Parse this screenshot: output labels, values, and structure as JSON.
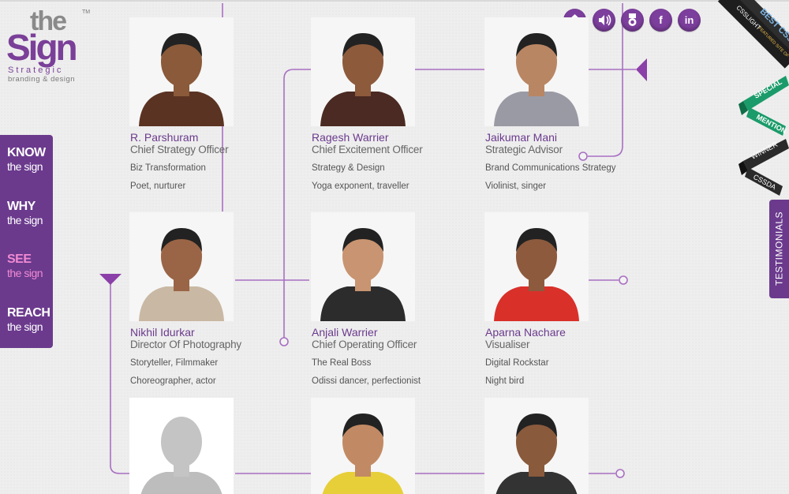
{
  "logo": {
    "the": "the",
    "tm": "TM",
    "sign": "Sign",
    "tagline1": "Strategic",
    "tagline2": "branding & design"
  },
  "nav": [
    {
      "key": "KNOW",
      "sub": "the sign"
    },
    {
      "key": "WHY",
      "sub": "the sign"
    },
    {
      "key": "SEE",
      "sub": "the sign",
      "active": true
    },
    {
      "key": "REACH",
      "sub": "the sign"
    }
  ],
  "social": [
    {
      "icon": "home-icon"
    },
    {
      "icon": "speaker-icon"
    },
    {
      "icon": "award-icon"
    },
    {
      "icon": "facebook-icon",
      "label": "f"
    },
    {
      "icon": "linkedin-icon",
      "label": "in"
    }
  ],
  "people": [
    {
      "name": "R. Parshuram",
      "role": "Chief Strategy Officer",
      "line1": "Biz Transformation",
      "line2": "Poet, nurturer",
      "shirt": "#5b3322",
      "skin": "#8a5a3a"
    },
    {
      "name": "Ragesh Warrier",
      "role": "Chief Excitement Officer",
      "line1": "Strategy & Design",
      "line2": "Yoga exponent, traveller",
      "shirt": "#4a2a22",
      "skin": "#8d5a3c"
    },
    {
      "name": "Jaikumar Mani",
      "role": "Strategic Advisor",
      "line1": "Brand Communications Strategy",
      "line2": "Violinist, singer",
      "shirt": "#9a9aa4",
      "skin": "#b98664"
    },
    {
      "name": "Nikhil Idurkar",
      "role": "Director Of Photography",
      "line1": "Storyteller, Filmmaker",
      "line2": "Choreographer, actor",
      "shirt": "#c9b8a3",
      "skin": "#9a6546"
    },
    {
      "name": "Anjali Warrier",
      "role": "Chief Operating Officer",
      "line1": "The Real Boss",
      "line2": "Odissi dancer, perfectionist",
      "shirt": "#2c2c2c",
      "skin": "#c99471"
    },
    {
      "name": "Aparna Nachare",
      "role": "Visualiser",
      "line1": "Digital Rockstar",
      "line2": "Night bird",
      "shirt": "#d9302a",
      "skin": "#8d5a3e"
    },
    {
      "name": "",
      "role": "",
      "line1": "",
      "line2": "",
      "shirt": "#bdbdbd",
      "skin": "#c4c4c4",
      "placeholder": true
    },
    {
      "name": "",
      "role": "",
      "line1": "",
      "line2": "",
      "shirt": "#e7cf3a",
      "skin": "#c28a64"
    },
    {
      "name": "",
      "role": "",
      "line1": "",
      "line2": "",
      "shirt": "#333333",
      "skin": "#8a5a3c"
    }
  ],
  "badges": {
    "best_css": "BEST CSS",
    "csslight": "CSSLIGHT",
    "featured": "FEATURED SITE OF THE DAY",
    "special": "SPECIAL",
    "mention": "MENTION",
    "winner": "WINNER",
    "cssda": "CSSDA"
  },
  "testimonials_label": "TESTIMONIALS",
  "colors": {
    "accent": "#6b3a8d",
    "active_nav": "#f08ad2",
    "line": "#9a5fb5"
  }
}
